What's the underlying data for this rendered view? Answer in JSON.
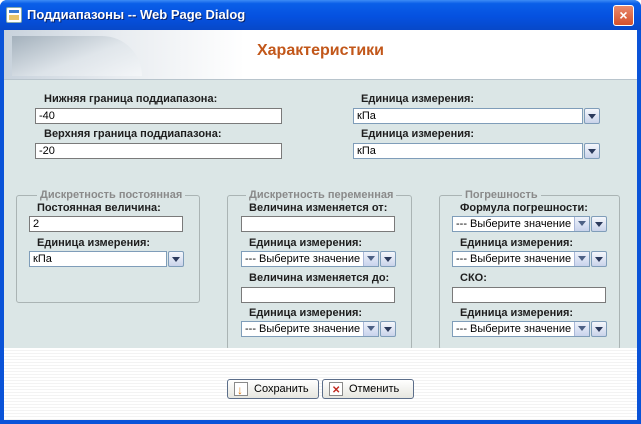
{
  "window": {
    "title": "Поддиапазоны -- Web Page Dialog",
    "close_glyph": "×"
  },
  "header": {
    "title": "Характеристики"
  },
  "range": {
    "lower_label": "Нижняя граница поддиапазона:",
    "lower_value": "-40",
    "upper_label": "Верхняя граница поддиапазона:",
    "upper_value": "-20",
    "unit1_label": "Единица измерения:",
    "unit1_value": "кПа",
    "unit2_label": "Единица измерения:",
    "unit2_value": "кПа"
  },
  "discrete_const": {
    "legend": "Дискретность постоянная",
    "value_label": "Постоянная величина:",
    "value": "2",
    "unit_label": "Единица измерения:",
    "unit_value": "кПа"
  },
  "discrete_var": {
    "legend": "Дискретность переменная",
    "from_label": "Величина изменяется от:",
    "from_value": "",
    "unit1_label": "Единица измерения:",
    "unit1_value": "--- Выберите значение ---",
    "to_label": "Величина изменяется до:",
    "to_value": "",
    "unit2_label": "Единица измерения:",
    "unit2_value": "--- Выберите значение ---"
  },
  "error": {
    "legend": "Погрешность",
    "formula_label": "Формула погрешности:",
    "formula_value": "--- Выберите значение ---",
    "unit1_label": "Единица измерения:",
    "unit1_value": "--- Выберите значение ---",
    "sko_label": "СКО:",
    "sko_value": "",
    "unit2_label": "Единица измерения:",
    "unit2_value": "--- Выберите значение ---"
  },
  "buttons": {
    "save": "Сохранить",
    "cancel": "Отменить"
  },
  "colors": {
    "title_accent": "#c2571a",
    "content_bg": "#dbe6e6",
    "titlebar": "#0551e0"
  }
}
